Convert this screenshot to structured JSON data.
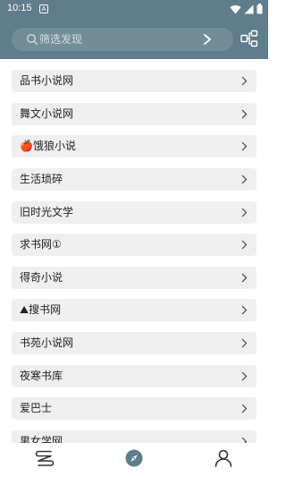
{
  "status_bar": {
    "time": "10:15",
    "app_icon_letter": "A",
    "icons": [
      "wifi-icon",
      "cellular-signal-icon",
      "battery-icon"
    ]
  },
  "search": {
    "placeholder": "筛选发现",
    "search_icon": "search-icon",
    "go_icon": "chevron-right-icon"
  },
  "header": {
    "action_icon": "flowchart-icon"
  },
  "colors": {
    "header_bg": "#5f7d8a",
    "search_bg": "#728d98",
    "item_bg": "#efefef",
    "active_tab": "#5f7d8a",
    "inactive_tab": "#333333"
  },
  "list": {
    "items": [
      {
        "label": "品书小说网"
      },
      {
        "label": "舞文小说网"
      },
      {
        "label": "🍎饿狼小说"
      },
      {
        "label": "生活琐碎"
      },
      {
        "label": "旧时光文学"
      },
      {
        "label": "求书网①"
      },
      {
        "label": "得奇小说"
      },
      {
        "label": "⛰搜书网"
      },
      {
        "label": "书苑小说网"
      },
      {
        "label": "夜寒书库"
      },
      {
        "label": "爱巴士"
      },
      {
        "label": "男女学网"
      }
    ]
  },
  "bottom_nav": {
    "tabs": [
      {
        "icon": "bookshelf-icon",
        "active": false
      },
      {
        "icon": "compass-icon",
        "active": true
      },
      {
        "icon": "person-icon",
        "active": false
      }
    ]
  }
}
